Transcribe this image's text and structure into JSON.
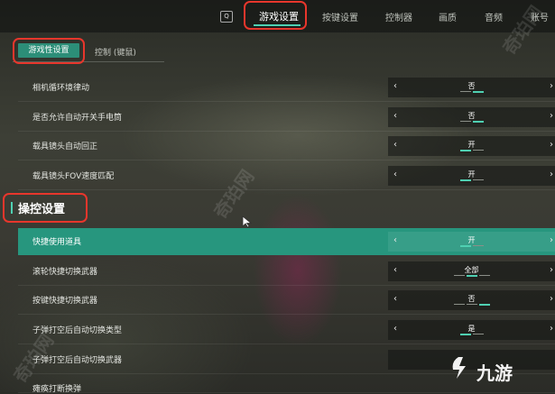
{
  "topnav": {
    "q_key": "Q",
    "tabs": [
      {
        "label": "游戏设置",
        "active": true
      },
      {
        "label": "按键设置",
        "active": false
      },
      {
        "label": "控制器",
        "active": false
      },
      {
        "label": "画质",
        "active": false
      },
      {
        "label": "音频",
        "active": false
      },
      {
        "label": "账号",
        "active": false
      }
    ]
  },
  "subtabs": {
    "active": "游戏性设置",
    "inactive": "控制 (键鼠)"
  },
  "rows": [
    {
      "label": "相机循环境律动",
      "value": "否",
      "ticks": 2,
      "on": 1
    },
    {
      "label": "是否允许自动开关手电筒",
      "value": "否",
      "ticks": 2,
      "on": 1
    },
    {
      "label": "载具镜头自动回正",
      "value": "开",
      "ticks": 2,
      "on": 0
    },
    {
      "label": "载具镜头FOV速度匹配",
      "value": "开",
      "ticks": 2,
      "on": 0
    }
  ],
  "section": {
    "title": "操控设置"
  },
  "control_rows": [
    {
      "label": "快捷使用道具",
      "value": "开",
      "ticks": 2,
      "on": 0
    },
    {
      "label": "滚轮快捷切换武器",
      "value": "全部",
      "ticks": 3,
      "on": 1
    },
    {
      "label": "按键快捷切换武器",
      "value": "否",
      "ticks": 3,
      "on": 2
    },
    {
      "label": "子弹打空后自动切换类型",
      "value": "是",
      "ticks": 2,
      "on": 0
    },
    {
      "label": "子弹打空后自动切换武器",
      "value": "",
      "ticks": 0,
      "on": 0
    },
    {
      "label": "瘫痪打断换弹",
      "value": "",
      "ticks": 0,
      "on": 0
    }
  ],
  "colors": {
    "accent": "#4fd0b2",
    "highlight_row": "#27967e",
    "annotation": "#e8362c"
  },
  "watermark": "奇珀网",
  "logo": "九游"
}
